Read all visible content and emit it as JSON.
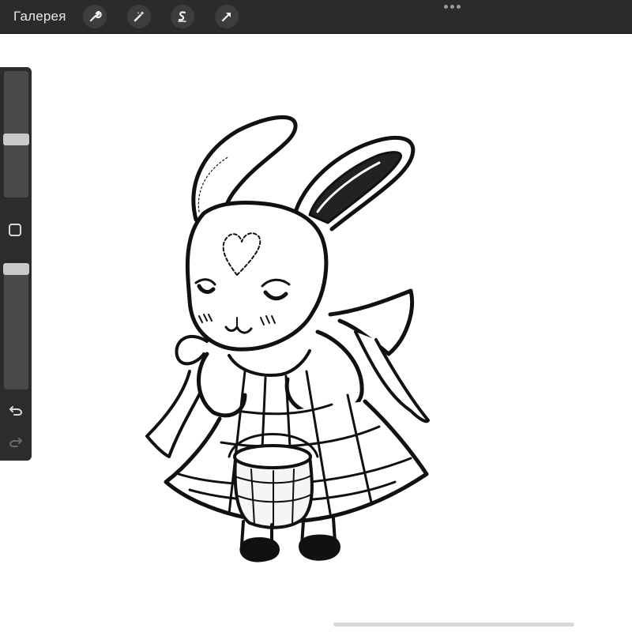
{
  "toolbar": {
    "gallery_label": "Галерея",
    "tools": [
      "wrench-icon",
      "magic-wand-icon",
      "selection-icon",
      "transform-arrow-icon"
    ],
    "more_icon": "more-dots-icon"
  },
  "sidebar": {
    "brush_size": 0.45,
    "opacity": 0.0,
    "modify_button_icon": "square-icon",
    "undo_icon": "undo-icon",
    "redo_icon": "redo-icon"
  },
  "colors": {
    "toolbar_bg": "#2b2b2b",
    "sidebar_bg": "#2c2c2c",
    "canvas_bg": "#ffffff"
  }
}
